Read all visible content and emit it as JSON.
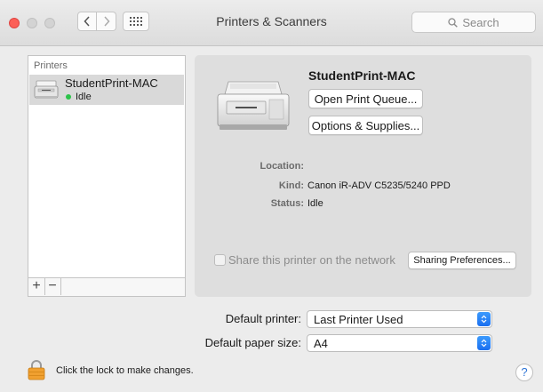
{
  "window": {
    "title": "Printers & Scanners",
    "search_placeholder": "Search"
  },
  "printers_list": {
    "header": "Printers",
    "items": [
      {
        "name": "StudentPrint-MAC",
        "status": "Idle",
        "status_color": "#2cc34a"
      }
    ],
    "add_label": "+",
    "remove_label": "−"
  },
  "printer_detail": {
    "name": "StudentPrint-MAC",
    "open_queue_label": "Open Print Queue...",
    "options_label": "Options & Supplies...",
    "location_label": "Location:",
    "location_value": "",
    "kind_label": "Kind:",
    "kind_value": "Canon iR-ADV C5235/5240 PPD",
    "status_label": "Status:",
    "status_value": "Idle",
    "share_label": "Share this printer on the network",
    "share_checked": false,
    "sharing_prefs_label": "Sharing Preferences..."
  },
  "defaults": {
    "printer_label": "Default printer:",
    "printer_value": "Last Printer Used",
    "paper_label": "Default paper size:",
    "paper_value": "A4"
  },
  "footer": {
    "lock_text": "Click the lock to make changes.",
    "help_label": "?"
  },
  "colors": {
    "close_button": "#fc5f57",
    "accent": "#1a6ff0",
    "lock": "#f0a030"
  }
}
